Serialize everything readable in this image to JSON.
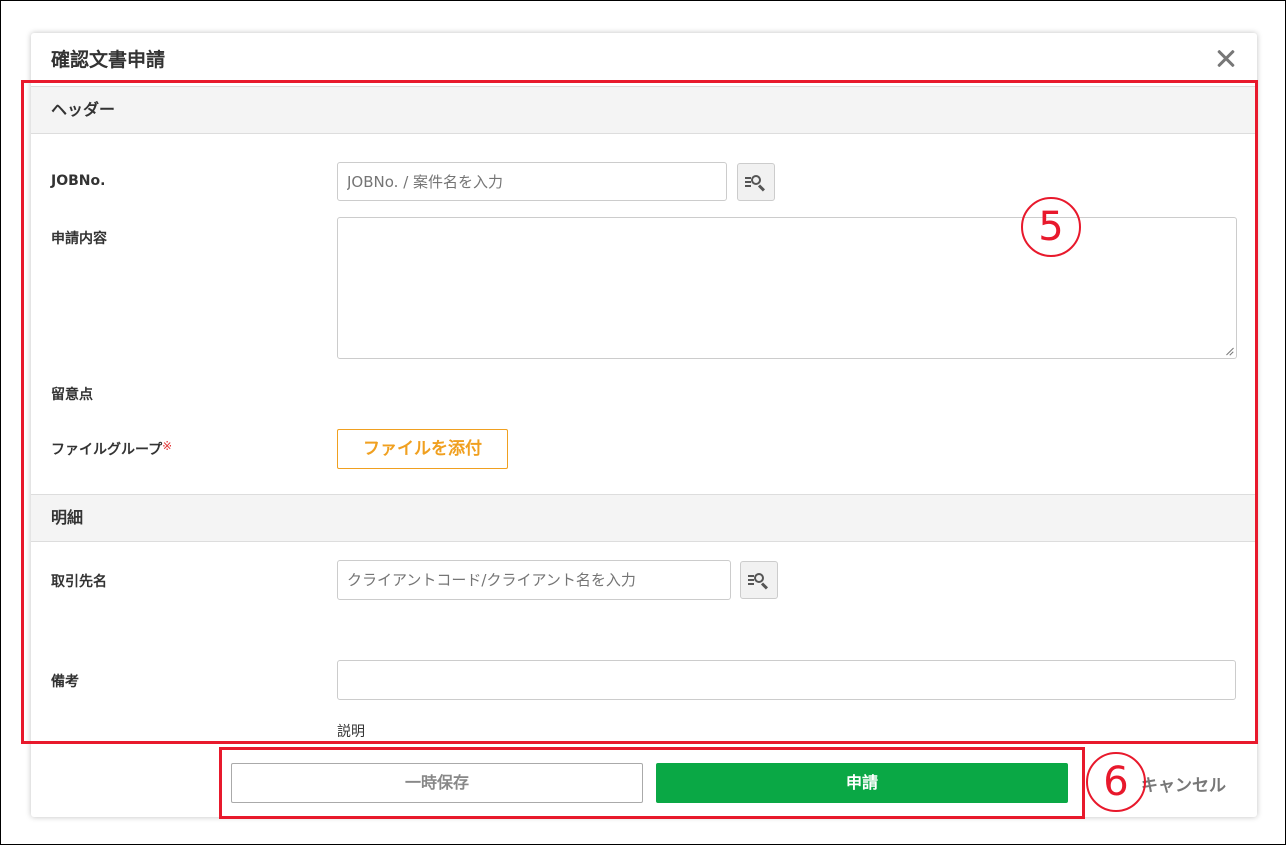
{
  "dialog": {
    "title": "確認文書申請"
  },
  "header_section": {
    "title": "ヘッダー",
    "job_no": {
      "label": "JOBNo.",
      "placeholder": "JOBNo. / 案件名を入力"
    },
    "request_content": {
      "label": "申請内容",
      "value": ""
    },
    "notes": {
      "label": "留意点"
    },
    "file_group": {
      "label": "ファイルグループ",
      "required_mark": "※",
      "attach_button": "ファイルを添付"
    }
  },
  "detail_section": {
    "title": "明細",
    "client": {
      "label": "取引先名",
      "placeholder": "クライアントコード/クライアント名を入力"
    },
    "remarks": {
      "label": "備考",
      "value": "",
      "description": "説明"
    }
  },
  "footer": {
    "save_label": "一時保存",
    "submit_label": "申請",
    "cancel_label": "キャンセル"
  },
  "annotations": {
    "label_5": "5",
    "label_6": "6",
    "color": "#e8192c"
  },
  "colors": {
    "submit": "#0aa845",
    "attach": "#f0a020",
    "required": "#e23a3a"
  }
}
